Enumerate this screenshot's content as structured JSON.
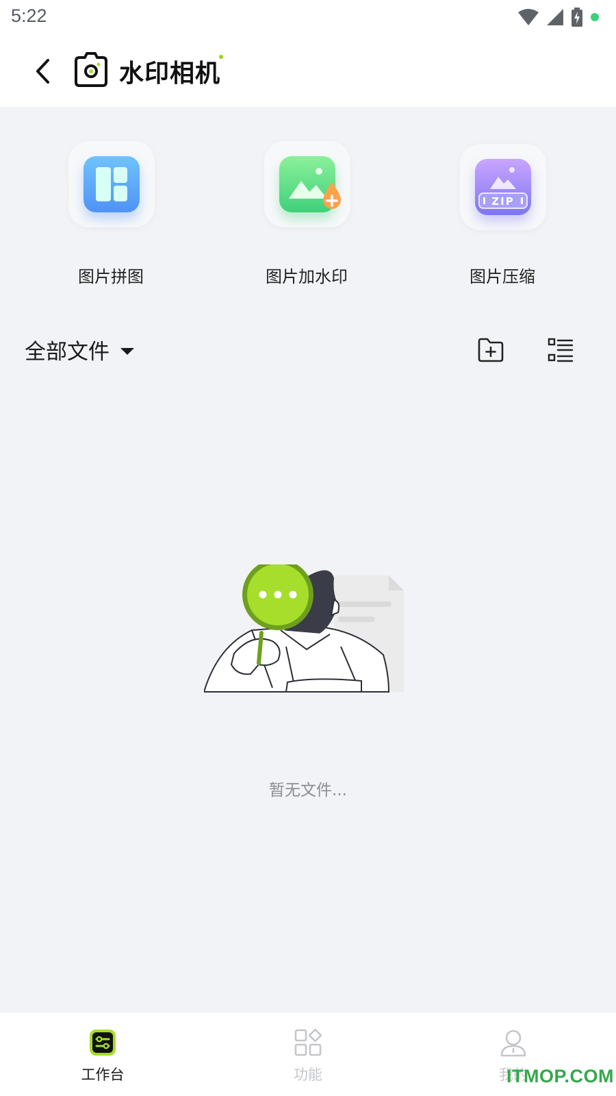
{
  "status_bar": {
    "time": "5:22"
  },
  "header": {
    "title": "水印相机"
  },
  "tools": [
    {
      "label": "图片拼图",
      "icon": "collage-icon"
    },
    {
      "label": "图片加水印",
      "icon": "image-watermark-icon"
    },
    {
      "label": "图片压缩",
      "icon": "zip-compress-icon",
      "badge": "ZIP"
    }
  ],
  "files": {
    "filter_label": "全部文件",
    "empty_text": "暂无文件..."
  },
  "tabbar": [
    {
      "label": "工作台",
      "icon": "workbench-icon",
      "active": true
    },
    {
      "label": "功能",
      "icon": "grid-icon",
      "active": false
    },
    {
      "label": "我的",
      "icon": "profile-icon",
      "active": false
    }
  ],
  "watermark": "ITMOP.COM",
  "colors": {
    "accent": "#a6de2b",
    "accent_dark": "#6ea01e",
    "background": "#f2f3f6"
  }
}
